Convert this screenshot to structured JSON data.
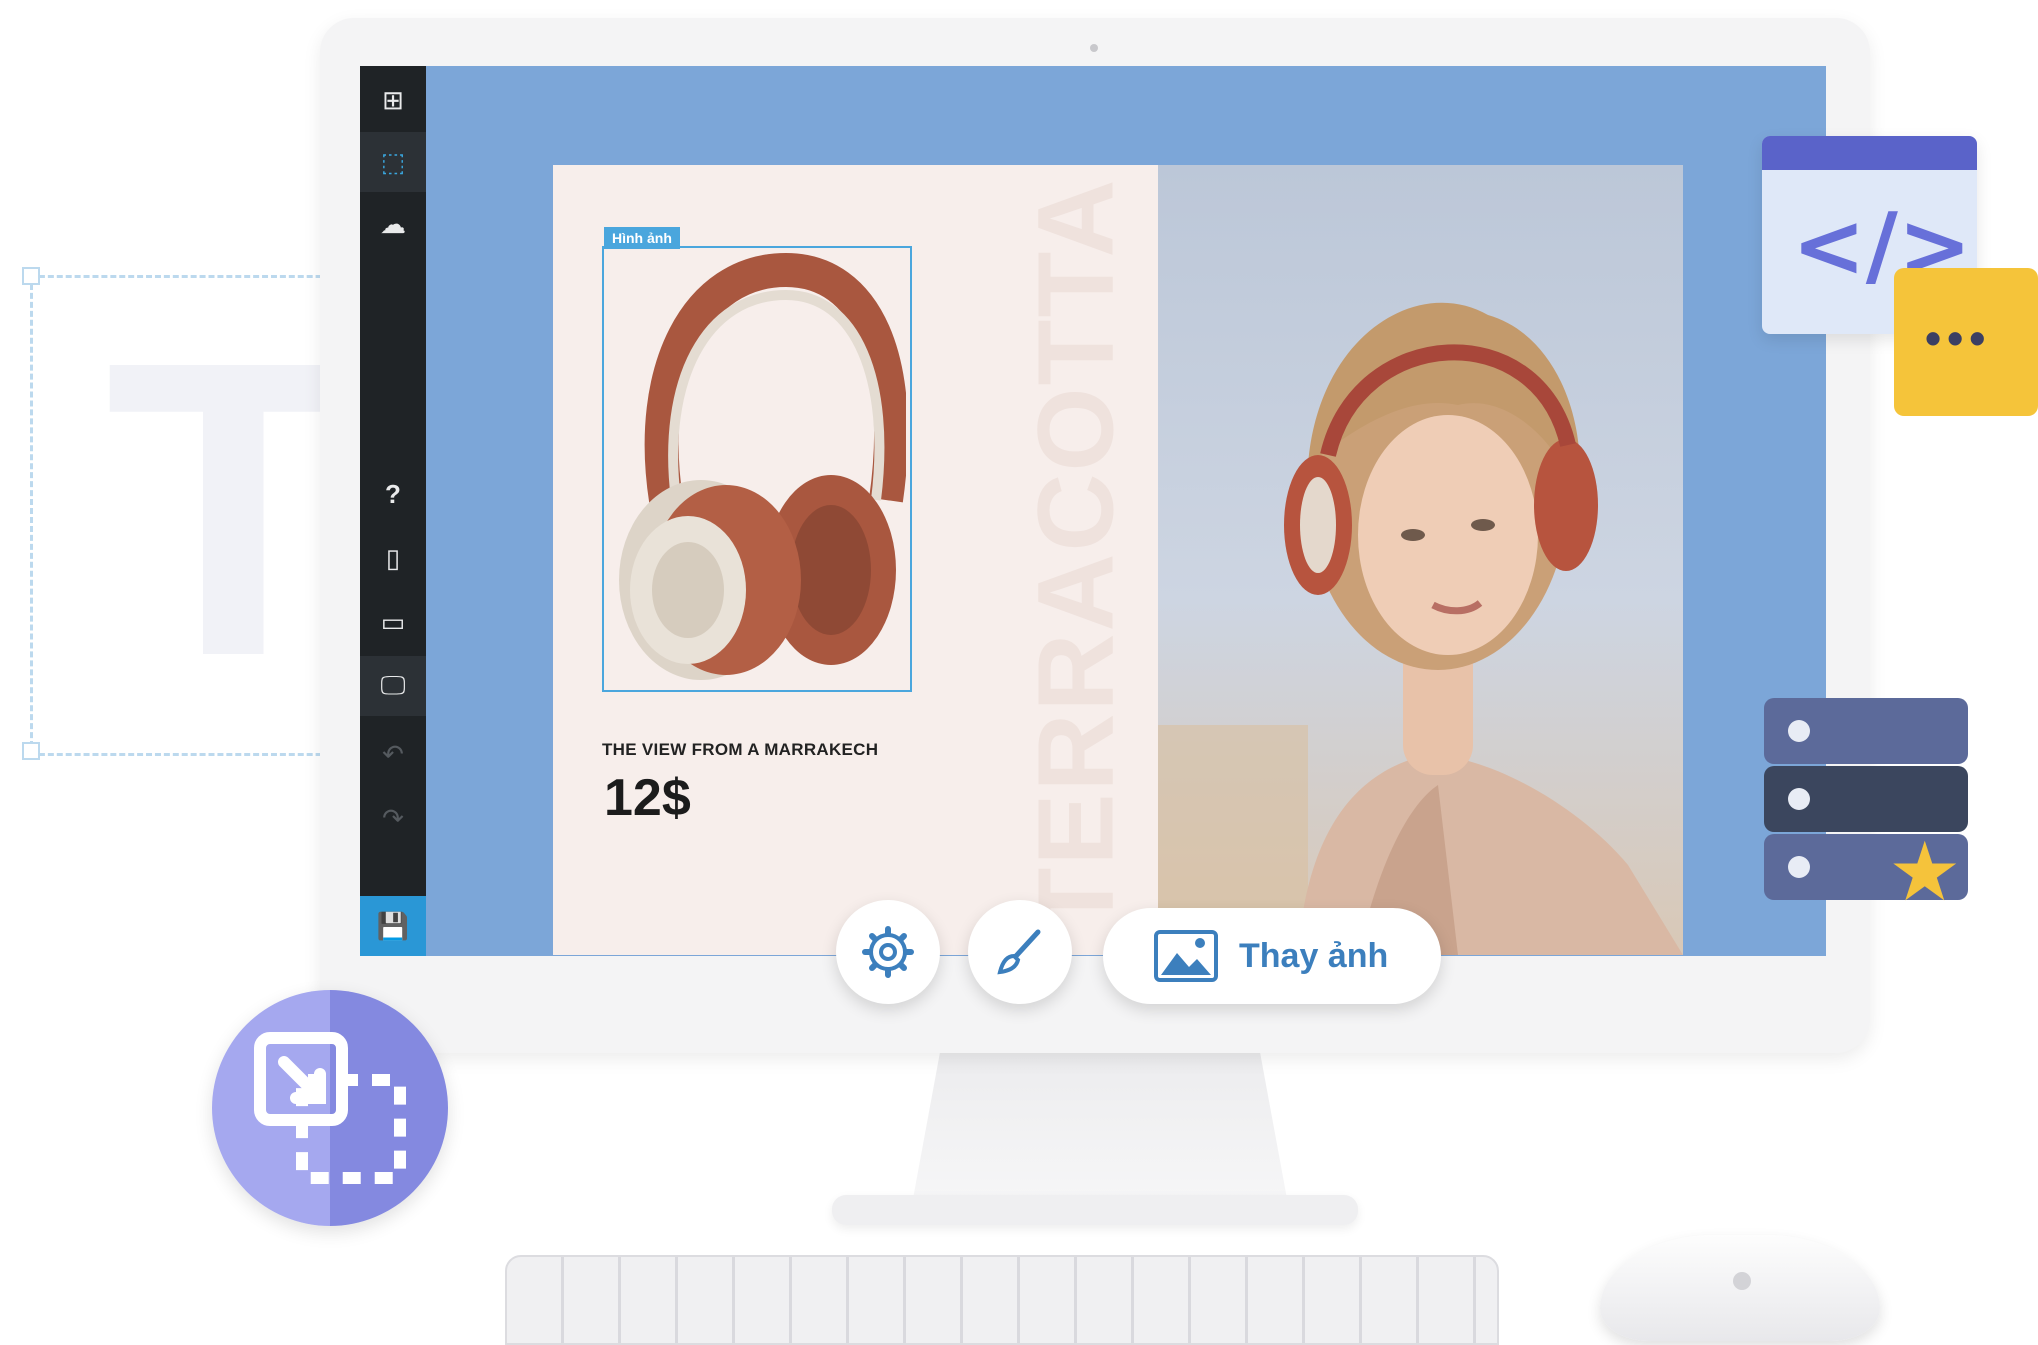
{
  "sidebar": {
    "items": [
      {
        "name": "add-element-icon",
        "glyph": "⊞"
      },
      {
        "name": "select-element-icon",
        "glyph": "⬚"
      },
      {
        "name": "cloud-upload-icon",
        "glyph": "☁"
      },
      {
        "name": "help-icon",
        "glyph": "?"
      },
      {
        "name": "mobile-view-icon",
        "glyph": "▯"
      },
      {
        "name": "tablet-view-icon",
        "glyph": "▭"
      },
      {
        "name": "desktop-view-icon",
        "glyph": "🖵"
      },
      {
        "name": "undo-icon",
        "glyph": "↶"
      },
      {
        "name": "redo-icon",
        "glyph": "↷"
      },
      {
        "name": "save-icon",
        "glyph": "💾"
      }
    ]
  },
  "canvas": {
    "image_tag": "Hình ảnh",
    "vertical_text": "TERRACOTTA",
    "product_title": "THE VIEW FROM A MARRAKECH",
    "product_price": "12$"
  },
  "toolbar": {
    "replace_image_label": "Thay ảnh"
  },
  "decor": {
    "background_letter": "T",
    "code_glyph": "</>",
    "chat_dots": "•••"
  },
  "colors": {
    "screen_bg": "#7ca6d8",
    "sidebar_bg": "#1f2326",
    "accent_blue": "#2a97d6",
    "card_bg": "#f7eeeb",
    "badge_purple": "#8489e0",
    "star_yellow": "#f5c33b"
  }
}
